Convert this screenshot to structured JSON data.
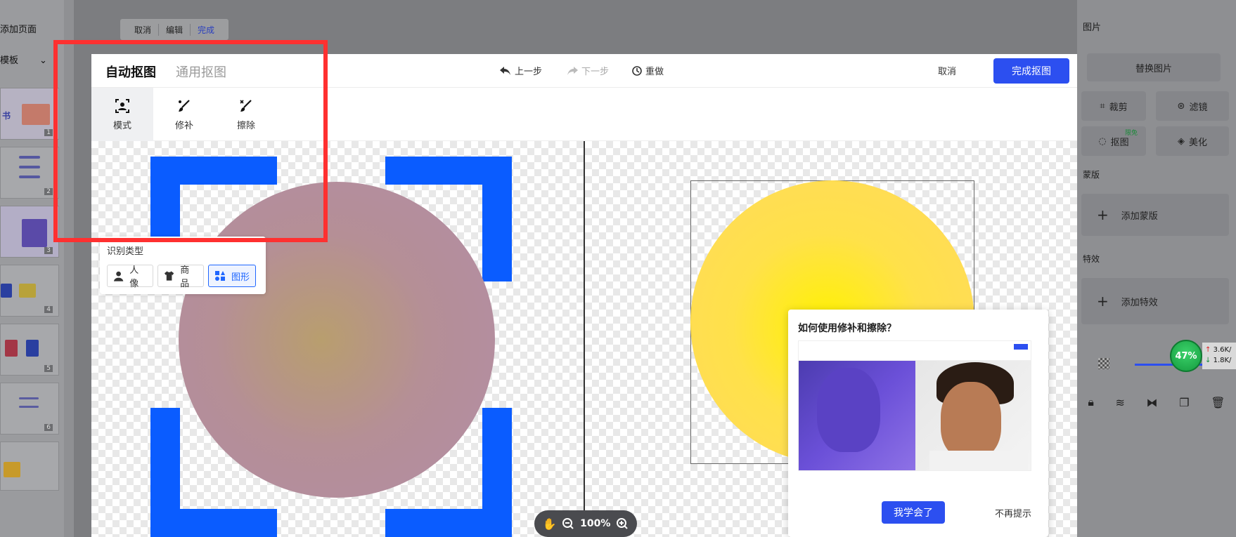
{
  "left_panel": {
    "add_page": "添加页面",
    "template": "模板",
    "thumb_text": "书",
    "thumbs": [
      "1",
      "2",
      "3",
      "4",
      "5",
      "6"
    ]
  },
  "floating_toolbar": {
    "cancel": "取消",
    "edit": "编辑",
    "done": "完成"
  },
  "modal": {
    "tab_auto": "自动抠图",
    "tab_general": "通用抠图",
    "undo": "上一步",
    "redo": "下一步",
    "reset": "重做",
    "cancel": "取消",
    "finish": "完成抠图",
    "tools": [
      {
        "label": "模式",
        "icon": "portrait-frame-icon"
      },
      {
        "label": "修补",
        "icon": "brush-icon"
      },
      {
        "label": "擦除",
        "icon": "eraser-icon"
      }
    ],
    "recognition": {
      "title": "识别类型",
      "options": [
        {
          "label": "人像",
          "icon": "person-icon"
        },
        {
          "label": "商品",
          "icon": "tshirt-icon"
        },
        {
          "label": "图形",
          "icon": "shapes-icon"
        }
      ],
      "selected": "图形"
    },
    "zoom": "100%"
  },
  "tutorial": {
    "title": "如何使用修补和擦除？",
    "learned": "我学会了",
    "dont_show": "不再提示"
  },
  "right_panel": {
    "section_image": "图片",
    "replace": "替换图片",
    "crop": "裁剪",
    "filter": "滤镜",
    "cutout": "抠图",
    "cutout_badge": "限免",
    "beautify": "美化",
    "mask": "蒙版",
    "add_mask": "添加蒙版",
    "effects": "特效",
    "add_effect": "添加特效"
  },
  "net_widget": {
    "percent": "47%",
    "up": "3.6K/",
    "down": "1.8K/"
  },
  "colors": {
    "brand": "#2c4ff0",
    "bracket": "#0a5cff",
    "highlight": "#ff3030"
  }
}
